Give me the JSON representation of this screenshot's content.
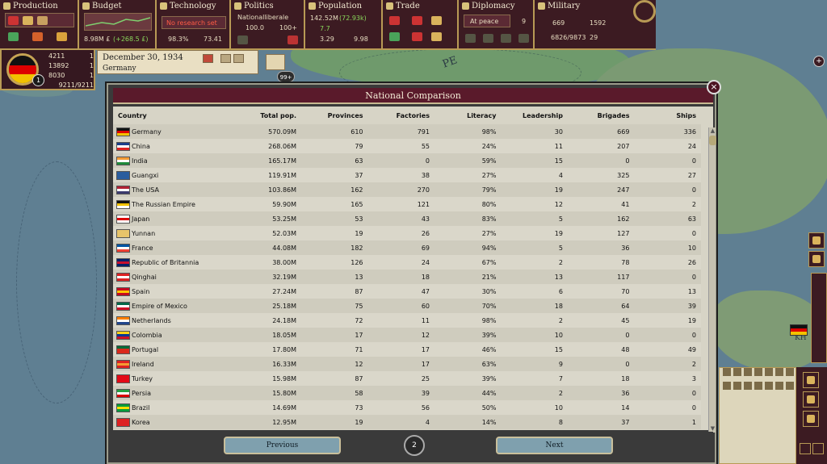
{
  "topbar": {
    "production": {
      "label": "Production"
    },
    "budget": {
      "label": "Budget",
      "funds": "8.98M £",
      "delta": "(+268.5 £)"
    },
    "technology": {
      "label": "Technology",
      "research": "No research set",
      "literacy": "98.3%",
      "points": "73.41"
    },
    "politics": {
      "label": "Politics",
      "party": "Nationalliberale",
      "plurality": "100.0",
      "consciousness": "100+"
    },
    "population": {
      "label": "Population",
      "total": "142.52M",
      "total_sub": "(72.93k)",
      "militancy": "7.7",
      "consciousness": "3.29",
      "score": "9.98"
    },
    "trade": {
      "label": "Trade"
    },
    "diplomacy": {
      "label": "Diplomacy",
      "status": "At peace",
      "count": "9"
    },
    "military": {
      "label": "Military",
      "army": "669",
      "manpower": "1592",
      "navy": "6826/9873",
      "ships": "29"
    }
  },
  "country_panel": {
    "prestige": "4211",
    "prestige_rank": "1",
    "industry": "13892",
    "industry_rank": "1",
    "military": "8030",
    "military_rank": "1",
    "overall_rank": "1",
    "score": "9211/9211",
    "date": "December 30, 1934",
    "country": "Germany",
    "messages": "99+"
  },
  "window": {
    "title": "National Comparison",
    "close": "×",
    "columns": [
      "Country",
      "Total pop.",
      "Provinces",
      "Factories",
      "Literacy",
      "Leadership",
      "Brigades",
      "Ships"
    ],
    "rows": [
      [
        "Germany",
        "570.09M",
        "610",
        "791",
        "98%",
        "30",
        "669",
        "336"
      ],
      [
        "China",
        "268.06M",
        "79",
        "55",
        "24%",
        "11",
        "207",
        "24"
      ],
      [
        "India",
        "165.17M",
        "63",
        "0",
        "59%",
        "15",
        "0",
        "0"
      ],
      [
        "Guangxi",
        "119.91M",
        "37",
        "38",
        "27%",
        "4",
        "325",
        "27"
      ],
      [
        "The USA",
        "103.86M",
        "162",
        "270",
        "79%",
        "19",
        "247",
        "0"
      ],
      [
        "The Russian Empire",
        "59.90M",
        "165",
        "121",
        "80%",
        "12",
        "41",
        "2"
      ],
      [
        "Japan",
        "53.25M",
        "53",
        "43",
        "83%",
        "5",
        "162",
        "63"
      ],
      [
        "Yunnan",
        "52.03M",
        "19",
        "26",
        "27%",
        "19",
        "127",
        "0"
      ],
      [
        "France",
        "44.08M",
        "182",
        "69",
        "94%",
        "5",
        "36",
        "10"
      ],
      [
        "Republic of Britannia",
        "38.00M",
        "126",
        "24",
        "67%",
        "2",
        "78",
        "26"
      ],
      [
        "Qinghai",
        "32.19M",
        "13",
        "18",
        "21%",
        "13",
        "117",
        "0"
      ],
      [
        "Spain",
        "27.24M",
        "87",
        "47",
        "30%",
        "6",
        "70",
        "13"
      ],
      [
        "Empire of Mexico",
        "25.18M",
        "75",
        "60",
        "70%",
        "18",
        "64",
        "39"
      ],
      [
        "Netherlands",
        "24.18M",
        "72",
        "11",
        "98%",
        "2",
        "45",
        "19"
      ],
      [
        "Colombia",
        "18.05M",
        "17",
        "12",
        "39%",
        "10",
        "0",
        "0"
      ],
      [
        "Portugal",
        "17.80M",
        "71",
        "17",
        "46%",
        "15",
        "48",
        "49"
      ],
      [
        "Ireland",
        "16.33M",
        "12",
        "17",
        "63%",
        "9",
        "0",
        "2"
      ],
      [
        "Turkey",
        "15.98M",
        "87",
        "25",
        "39%",
        "7",
        "18",
        "3"
      ],
      [
        "Persia",
        "15.80M",
        "58",
        "39",
        "44%",
        "2",
        "36",
        "0"
      ],
      [
        "Brazil",
        "14.69M",
        "73",
        "56",
        "50%",
        "10",
        "14",
        "0"
      ],
      [
        "Korea",
        "12.95M",
        "19",
        "4",
        "14%",
        "8",
        "37",
        "1"
      ]
    ],
    "flags": [
      [
        "#111",
        "#d00",
        "#f2c200"
      ],
      [
        "#1a3e8a",
        "#fff",
        "#d22"
      ],
      [
        "#f39a32",
        "#fff",
        "#1f8a3a"
      ],
      [
        "#2a5d9e",
        "#2a5d9e",
        "#2a5d9e"
      ],
      [
        "#b22234",
        "#fff",
        "#3c3b6e"
      ],
      [
        "#111",
        "#f2c200",
        "#fff"
      ],
      [
        "#fff",
        "#d00",
        "#fff"
      ],
      [
        "#e8c46a",
        "#e8c46a",
        "#e8c46a"
      ],
      [
        "#0055a4",
        "#fff",
        "#ef4135"
      ],
      [
        "#012169",
        "#c8102e",
        "#012169"
      ],
      [
        "#d22",
        "#fff",
        "#d22"
      ],
      [
        "#c60b1e",
        "#ffc400",
        "#c60b1e"
      ],
      [
        "#006847",
        "#fff",
        "#ce1126"
      ],
      [
        "#ff7f00",
        "#fff",
        "#21468b"
      ],
      [
        "#fcd116",
        "#003893",
        "#ce1126"
      ],
      [
        "#046a38",
        "#da291c",
        "#da291c"
      ],
      [
        "#d22",
        "#f39a32",
        "#d22"
      ],
      [
        "#e30a17",
        "#e30a17",
        "#e30a17"
      ],
      [
        "#239f40",
        "#fff",
        "#da0000"
      ],
      [
        "#009c3b",
        "#ffdf00",
        "#009c3b"
      ],
      [
        "#d22",
        "#d22",
        "#d22"
      ]
    ],
    "previous": "Previous",
    "page": "2",
    "next": "Next"
  },
  "map": {
    "label_pe": "PE",
    "label_kh": "KH"
  }
}
